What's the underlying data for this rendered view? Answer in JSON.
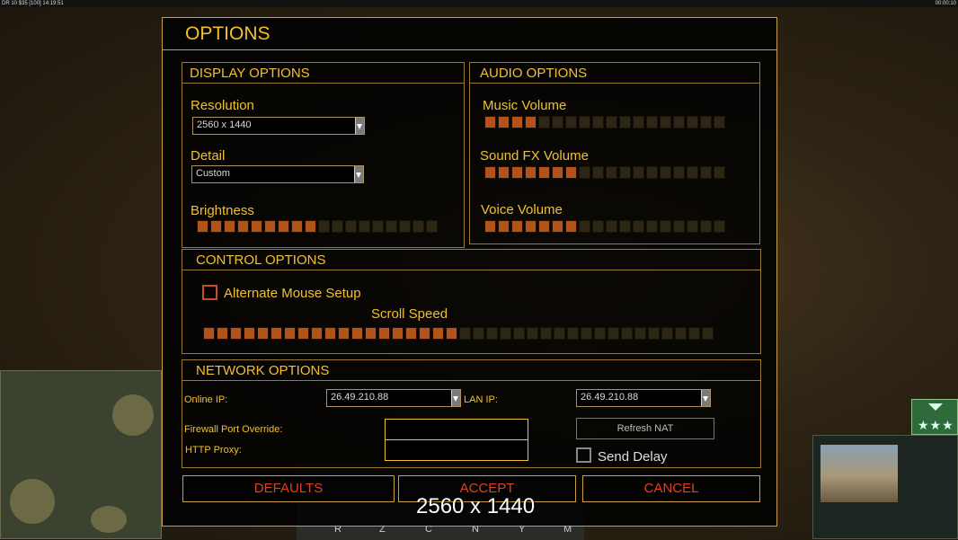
{
  "hud": {
    "top_left": "DR 10 $35 [100] 14:19:51",
    "top_right": "00:00:10",
    "command_hotkeys": [
      "R",
      "Z",
      "C",
      "N",
      "Y",
      "M"
    ]
  },
  "dialog": {
    "title": "OPTIONS",
    "display": {
      "title": "DISPLAY OPTIONS",
      "resolution_label": "Resolution",
      "resolution_value": "2560 x 1440",
      "detail_label": "Detail",
      "detail_value": "Custom",
      "brightness_label": "Brightness",
      "brightness_level": 0.5
    },
    "audio": {
      "title": "AUDIO OPTIONS",
      "music_label": "Music Volume",
      "music_level": 0.2,
      "sfx_label": "Sound FX Volume",
      "sfx_level": 0.4,
      "voice_label": "Voice Volume",
      "voice_level": 0.4
    },
    "control": {
      "title": "CONTROL OPTIONS",
      "alternate_mouse_label": "Alternate Mouse Setup",
      "alternate_mouse_checked": false,
      "scroll_speed_label": "Scroll Speed",
      "scroll_speed_level": 0.5
    },
    "network": {
      "title": "NETWORK OPTIONS",
      "online_ip_label": "Online IP:",
      "online_ip_value": "26.49.210.88",
      "lan_ip_label": "LAN IP:",
      "lan_ip_value": "26.49.210.88",
      "firewall_label": "Firewall Port Override:",
      "firewall_value": "",
      "http_proxy_label": "HTTP Proxy:",
      "http_proxy_value": "",
      "refresh_nat_label": "Refresh NAT",
      "send_delay_label": "Send Delay",
      "send_delay_checked": false
    },
    "buttons": {
      "defaults": "DEFAULTS",
      "accept": "ACCEPT",
      "cancel": "CANCEL"
    }
  },
  "resolution_overlay": "2560 x 1440",
  "colors": {
    "accent_gold": "#f0c030",
    "slider_on": "#b4521c",
    "button_text": "#e04020"
  }
}
